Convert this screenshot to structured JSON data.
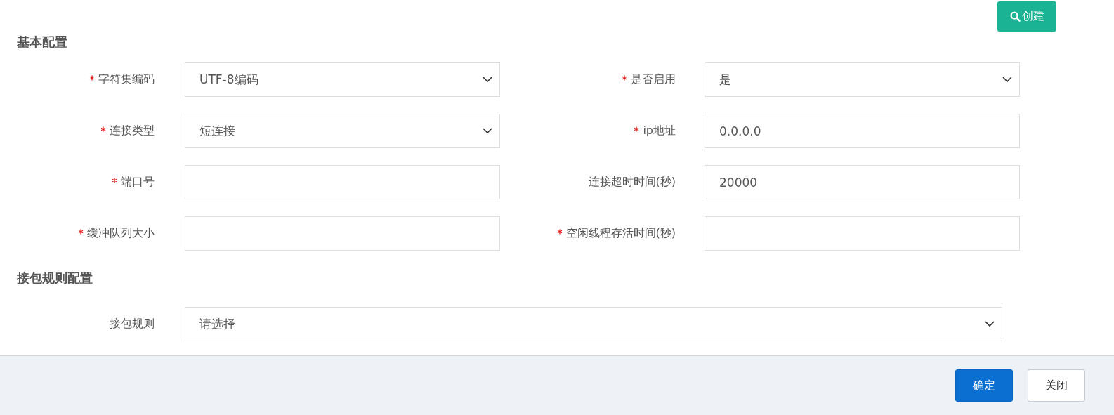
{
  "create_button": {
    "label": "创建"
  },
  "sections": [
    {
      "title": "基本配置",
      "rows": [
        [
          {
            "label": "字符集编码",
            "required": true,
            "kind": "select",
            "value": "UTF-8编码"
          },
          {
            "label": "是否启用",
            "required": true,
            "kind": "select",
            "value": "是"
          }
        ],
        [
          {
            "label": "连接类型",
            "required": true,
            "kind": "select",
            "value": "短连接"
          },
          {
            "label": "ip地址",
            "required": true,
            "kind": "input",
            "value": "0.0.0.0"
          }
        ],
        [
          {
            "label": "端口号",
            "required": true,
            "kind": "input"
          },
          {
            "label": "连接超时时间(秒)",
            "required": false,
            "kind": "input",
            "value": "20000"
          }
        ],
        [
          {
            "label": "缓冲队列大小",
            "required": true,
            "kind": "input"
          },
          {
            "label": "空闲线程存活时间(秒)",
            "required": true,
            "kind": "input"
          }
        ]
      ]
    },
    {
      "title": "接包规则配置",
      "rows": [
        [
          {
            "label": "接包规则",
            "required": false,
            "kind": "select",
            "value": "请选择",
            "wide": true
          }
        ]
      ]
    }
  ],
  "footer": {
    "buttons": [
      {
        "label": "确定",
        "kind": "primary"
      },
      {
        "label": "关闭",
        "kind": "default"
      }
    ]
  }
}
